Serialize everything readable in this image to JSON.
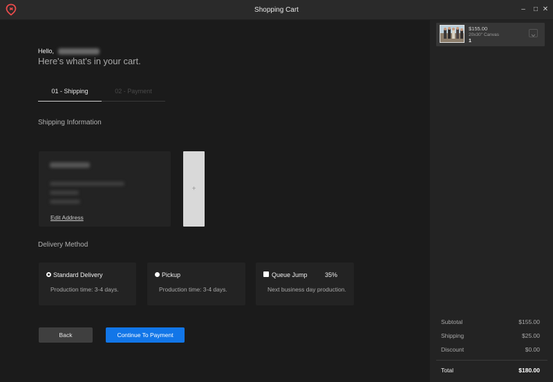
{
  "window": {
    "title": "Shopping Cart",
    "minimize_icon": "minimize-icon",
    "maximize_icon": "maximize-icon",
    "close_icon": "close-icon",
    "min_glyph": "–",
    "max_glyph": "□",
    "close_glyph": "✕",
    "brand_color": "#e94b4b"
  },
  "greeting": {
    "hello": "Hello,",
    "subtitle": "Here's what's in your cart."
  },
  "tabs": [
    {
      "label": "01 - Shipping",
      "active": true
    },
    {
      "label": "02 - Payment",
      "active": false
    }
  ],
  "shipping": {
    "section_label": "Shipping Information",
    "edit_address": "Edit Address",
    "add_symbol": "+"
  },
  "delivery": {
    "section_label": "Delivery Method",
    "options": [
      {
        "label": "Standard Delivery",
        "description": "Production time: 3-4 days.",
        "selected": true
      },
      {
        "label": "Pickup",
        "description": "Production time: 3-4 days.",
        "selected": false
      },
      {
        "label": "Queue Jump",
        "badge": "35%",
        "description": "Next business day production.",
        "selected": false
      }
    ]
  },
  "buttons": {
    "back": "Back",
    "continue": "Continue To Payment",
    "accent_color": "#1276e8"
  },
  "cart": {
    "item": {
      "price": "$155.00",
      "description": "20x30\" Canvas",
      "quantity": "1"
    },
    "summary": {
      "subtotal_label": "Subtotal",
      "subtotal_value": "$155.00",
      "shipping_label": "Shipping",
      "shipping_value": "$25.00",
      "discount_label": "Discount",
      "discount_value": "$0.00",
      "total_label": "Total",
      "total_value": "$180.00"
    }
  }
}
